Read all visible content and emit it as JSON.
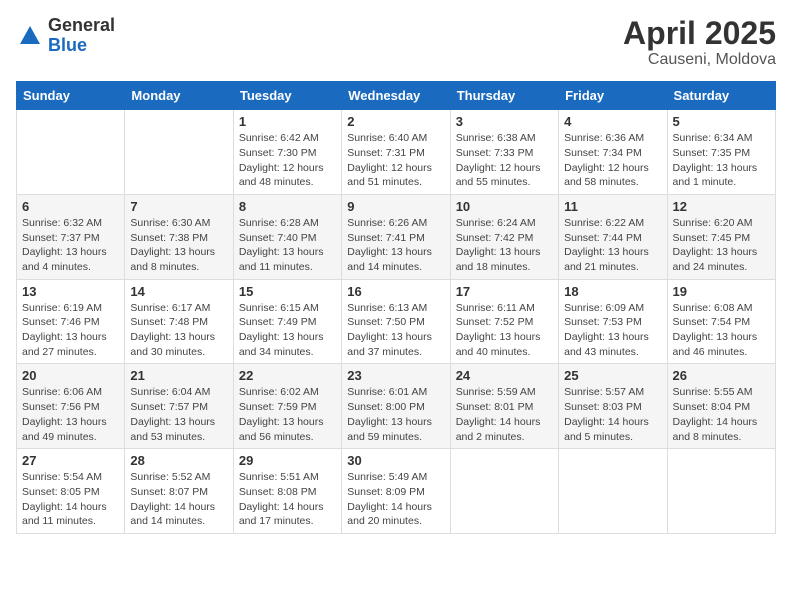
{
  "logo": {
    "general": "General",
    "blue": "Blue"
  },
  "title": {
    "month": "April 2025",
    "location": "Causeni, Moldova"
  },
  "headers": [
    "Sunday",
    "Monday",
    "Tuesday",
    "Wednesday",
    "Thursday",
    "Friday",
    "Saturday"
  ],
  "weeks": [
    [
      {
        "day": "",
        "sunrise": "",
        "sunset": "",
        "daylight": ""
      },
      {
        "day": "",
        "sunrise": "",
        "sunset": "",
        "daylight": ""
      },
      {
        "day": "1",
        "sunrise": "Sunrise: 6:42 AM",
        "sunset": "Sunset: 7:30 PM",
        "daylight": "Daylight: 12 hours and 48 minutes."
      },
      {
        "day": "2",
        "sunrise": "Sunrise: 6:40 AM",
        "sunset": "Sunset: 7:31 PM",
        "daylight": "Daylight: 12 hours and 51 minutes."
      },
      {
        "day": "3",
        "sunrise": "Sunrise: 6:38 AM",
        "sunset": "Sunset: 7:33 PM",
        "daylight": "Daylight: 12 hours and 55 minutes."
      },
      {
        "day": "4",
        "sunrise": "Sunrise: 6:36 AM",
        "sunset": "Sunset: 7:34 PM",
        "daylight": "Daylight: 12 hours and 58 minutes."
      },
      {
        "day": "5",
        "sunrise": "Sunrise: 6:34 AM",
        "sunset": "Sunset: 7:35 PM",
        "daylight": "Daylight: 13 hours and 1 minute."
      }
    ],
    [
      {
        "day": "6",
        "sunrise": "Sunrise: 6:32 AM",
        "sunset": "Sunset: 7:37 PM",
        "daylight": "Daylight: 13 hours and 4 minutes."
      },
      {
        "day": "7",
        "sunrise": "Sunrise: 6:30 AM",
        "sunset": "Sunset: 7:38 PM",
        "daylight": "Daylight: 13 hours and 8 minutes."
      },
      {
        "day": "8",
        "sunrise": "Sunrise: 6:28 AM",
        "sunset": "Sunset: 7:40 PM",
        "daylight": "Daylight: 13 hours and 11 minutes."
      },
      {
        "day": "9",
        "sunrise": "Sunrise: 6:26 AM",
        "sunset": "Sunset: 7:41 PM",
        "daylight": "Daylight: 13 hours and 14 minutes."
      },
      {
        "day": "10",
        "sunrise": "Sunrise: 6:24 AM",
        "sunset": "Sunset: 7:42 PM",
        "daylight": "Daylight: 13 hours and 18 minutes."
      },
      {
        "day": "11",
        "sunrise": "Sunrise: 6:22 AM",
        "sunset": "Sunset: 7:44 PM",
        "daylight": "Daylight: 13 hours and 21 minutes."
      },
      {
        "day": "12",
        "sunrise": "Sunrise: 6:20 AM",
        "sunset": "Sunset: 7:45 PM",
        "daylight": "Daylight: 13 hours and 24 minutes."
      }
    ],
    [
      {
        "day": "13",
        "sunrise": "Sunrise: 6:19 AM",
        "sunset": "Sunset: 7:46 PM",
        "daylight": "Daylight: 13 hours and 27 minutes."
      },
      {
        "day": "14",
        "sunrise": "Sunrise: 6:17 AM",
        "sunset": "Sunset: 7:48 PM",
        "daylight": "Daylight: 13 hours and 30 minutes."
      },
      {
        "day": "15",
        "sunrise": "Sunrise: 6:15 AM",
        "sunset": "Sunset: 7:49 PM",
        "daylight": "Daylight: 13 hours and 34 minutes."
      },
      {
        "day": "16",
        "sunrise": "Sunrise: 6:13 AM",
        "sunset": "Sunset: 7:50 PM",
        "daylight": "Daylight: 13 hours and 37 minutes."
      },
      {
        "day": "17",
        "sunrise": "Sunrise: 6:11 AM",
        "sunset": "Sunset: 7:52 PM",
        "daylight": "Daylight: 13 hours and 40 minutes."
      },
      {
        "day": "18",
        "sunrise": "Sunrise: 6:09 AM",
        "sunset": "Sunset: 7:53 PM",
        "daylight": "Daylight: 13 hours and 43 minutes."
      },
      {
        "day": "19",
        "sunrise": "Sunrise: 6:08 AM",
        "sunset": "Sunset: 7:54 PM",
        "daylight": "Daylight: 13 hours and 46 minutes."
      }
    ],
    [
      {
        "day": "20",
        "sunrise": "Sunrise: 6:06 AM",
        "sunset": "Sunset: 7:56 PM",
        "daylight": "Daylight: 13 hours and 49 minutes."
      },
      {
        "day": "21",
        "sunrise": "Sunrise: 6:04 AM",
        "sunset": "Sunset: 7:57 PM",
        "daylight": "Daylight: 13 hours and 53 minutes."
      },
      {
        "day": "22",
        "sunrise": "Sunrise: 6:02 AM",
        "sunset": "Sunset: 7:59 PM",
        "daylight": "Daylight: 13 hours and 56 minutes."
      },
      {
        "day": "23",
        "sunrise": "Sunrise: 6:01 AM",
        "sunset": "Sunset: 8:00 PM",
        "daylight": "Daylight: 13 hours and 59 minutes."
      },
      {
        "day": "24",
        "sunrise": "Sunrise: 5:59 AM",
        "sunset": "Sunset: 8:01 PM",
        "daylight": "Daylight: 14 hours and 2 minutes."
      },
      {
        "day": "25",
        "sunrise": "Sunrise: 5:57 AM",
        "sunset": "Sunset: 8:03 PM",
        "daylight": "Daylight: 14 hours and 5 minutes."
      },
      {
        "day": "26",
        "sunrise": "Sunrise: 5:55 AM",
        "sunset": "Sunset: 8:04 PM",
        "daylight": "Daylight: 14 hours and 8 minutes."
      }
    ],
    [
      {
        "day": "27",
        "sunrise": "Sunrise: 5:54 AM",
        "sunset": "Sunset: 8:05 PM",
        "daylight": "Daylight: 14 hours and 11 minutes."
      },
      {
        "day": "28",
        "sunrise": "Sunrise: 5:52 AM",
        "sunset": "Sunset: 8:07 PM",
        "daylight": "Daylight: 14 hours and 14 minutes."
      },
      {
        "day": "29",
        "sunrise": "Sunrise: 5:51 AM",
        "sunset": "Sunset: 8:08 PM",
        "daylight": "Daylight: 14 hours and 17 minutes."
      },
      {
        "day": "30",
        "sunrise": "Sunrise: 5:49 AM",
        "sunset": "Sunset: 8:09 PM",
        "daylight": "Daylight: 14 hours and 20 minutes."
      },
      {
        "day": "",
        "sunrise": "",
        "sunset": "",
        "daylight": ""
      },
      {
        "day": "",
        "sunrise": "",
        "sunset": "",
        "daylight": ""
      },
      {
        "day": "",
        "sunrise": "",
        "sunset": "",
        "daylight": ""
      }
    ]
  ]
}
